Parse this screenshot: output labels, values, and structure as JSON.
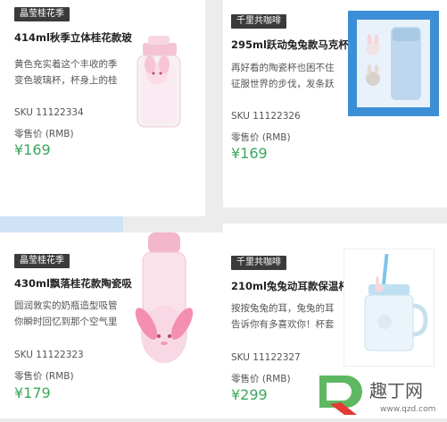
{
  "cards": [
    {
      "tag": "晶莹桂花季",
      "title": "414ml秋季立体桂花款玻",
      "desc_line1": "黄色充实着这个丰收的季",
      "desc_line2": "变色玻璃杯，杯身上的桂",
      "sku": "SKU 11122334",
      "price_label": "零售价 (RMB)",
      "price": "¥169"
    },
    {
      "tag": "千里共咖啡",
      "title": "295ml跃动兔兔款马克杯",
      "desc_line1": "再好看的陶瓷杯也困不住",
      "desc_line2": "征服世界的步伐，发条跃",
      "sku": "SKU 11122326",
      "price_label": "零售价 (RMB)",
      "price": "¥169"
    },
    {
      "tag": "晶莹桂花季",
      "title": "430ml飘落桂花款陶瓷吸",
      "desc_line1": "圆润敦实的奶瓶造型吸管",
      "desc_line2": "你瞬时回忆到那个空气里",
      "sku": "SKU 11122323",
      "price_label": "零售价 (RMB)",
      "price": "¥179"
    },
    {
      "tag": "千里共咖啡",
      "title": "210ml兔兔动耳款保温杯",
      "desc_line1": "按按兔兔的耳，兔兔的耳",
      "desc_line2": "告诉你有多喜欢你！杯套",
      "sku": "SKU 11122327",
      "price_label": "零售价 (RMB)",
      "price": "¥299"
    }
  ],
  "watermark": {
    "brand": "趣丁网",
    "url": "www.qzd.com"
  },
  "colors": {
    "price": "#3aa85c",
    "tag_bg": "#3b3b3b"
  }
}
